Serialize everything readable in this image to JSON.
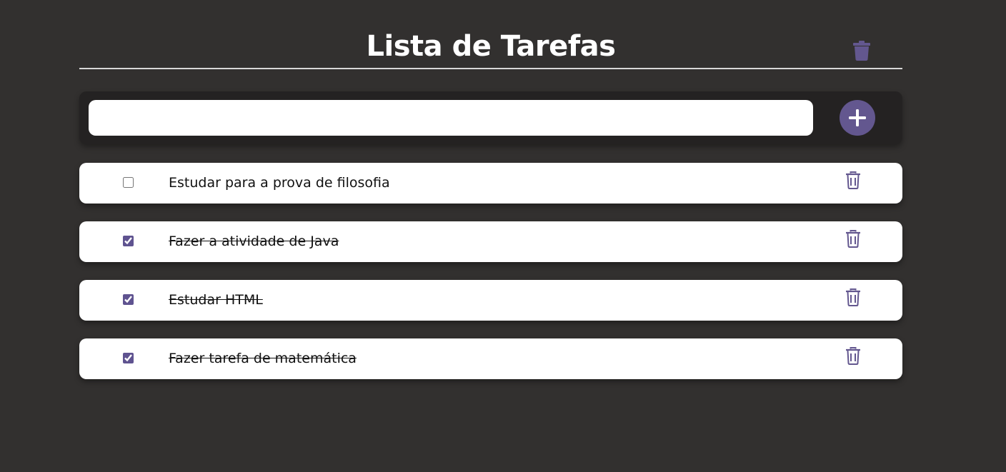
{
  "header": {
    "title": "Lista de Tarefas",
    "clear_icon": "trash-icon"
  },
  "input": {
    "value": "",
    "placeholder": "",
    "add_icon": "plus-icon"
  },
  "tasks": [
    {
      "text": "Estudar para a prova de filosofia",
      "done": false
    },
    {
      "text": "Fazer a atividade de Java",
      "done": true
    },
    {
      "text": "Estudar HTML",
      "done": true
    },
    {
      "text": "Fazer tarefa de matemática",
      "done": true
    }
  ],
  "colors": {
    "background": "#32302f",
    "accent": "#63578f",
    "panel": "#242222",
    "card": "#ffffff"
  }
}
